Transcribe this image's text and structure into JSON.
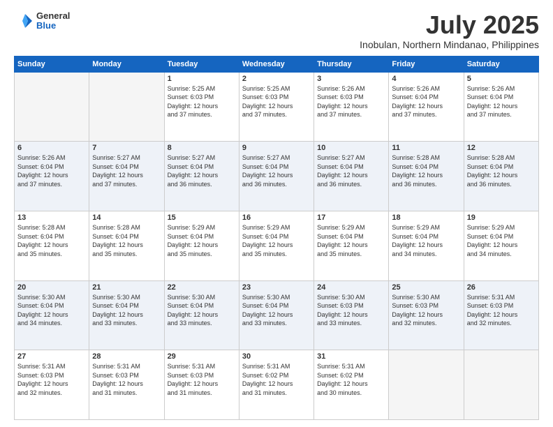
{
  "header": {
    "logo_general": "General",
    "logo_blue": "Blue",
    "month_title": "July 2025",
    "location": "Inobulan, Northern Mindanao, Philippines"
  },
  "weekdays": [
    "Sunday",
    "Monday",
    "Tuesday",
    "Wednesday",
    "Thursday",
    "Friday",
    "Saturday"
  ],
  "weeks": [
    [
      {
        "day": "",
        "info": ""
      },
      {
        "day": "",
        "info": ""
      },
      {
        "day": "1",
        "info": "Sunrise: 5:25 AM\nSunset: 6:03 PM\nDaylight: 12 hours\nand 37 minutes."
      },
      {
        "day": "2",
        "info": "Sunrise: 5:25 AM\nSunset: 6:03 PM\nDaylight: 12 hours\nand 37 minutes."
      },
      {
        "day": "3",
        "info": "Sunrise: 5:26 AM\nSunset: 6:03 PM\nDaylight: 12 hours\nand 37 minutes."
      },
      {
        "day": "4",
        "info": "Sunrise: 5:26 AM\nSunset: 6:04 PM\nDaylight: 12 hours\nand 37 minutes."
      },
      {
        "day": "5",
        "info": "Sunrise: 5:26 AM\nSunset: 6:04 PM\nDaylight: 12 hours\nand 37 minutes."
      }
    ],
    [
      {
        "day": "6",
        "info": "Sunrise: 5:26 AM\nSunset: 6:04 PM\nDaylight: 12 hours\nand 37 minutes."
      },
      {
        "day": "7",
        "info": "Sunrise: 5:27 AM\nSunset: 6:04 PM\nDaylight: 12 hours\nand 37 minutes."
      },
      {
        "day": "8",
        "info": "Sunrise: 5:27 AM\nSunset: 6:04 PM\nDaylight: 12 hours\nand 36 minutes."
      },
      {
        "day": "9",
        "info": "Sunrise: 5:27 AM\nSunset: 6:04 PM\nDaylight: 12 hours\nand 36 minutes."
      },
      {
        "day": "10",
        "info": "Sunrise: 5:27 AM\nSunset: 6:04 PM\nDaylight: 12 hours\nand 36 minutes."
      },
      {
        "day": "11",
        "info": "Sunrise: 5:28 AM\nSunset: 6:04 PM\nDaylight: 12 hours\nand 36 minutes."
      },
      {
        "day": "12",
        "info": "Sunrise: 5:28 AM\nSunset: 6:04 PM\nDaylight: 12 hours\nand 36 minutes."
      }
    ],
    [
      {
        "day": "13",
        "info": "Sunrise: 5:28 AM\nSunset: 6:04 PM\nDaylight: 12 hours\nand 35 minutes."
      },
      {
        "day": "14",
        "info": "Sunrise: 5:28 AM\nSunset: 6:04 PM\nDaylight: 12 hours\nand 35 minutes."
      },
      {
        "day": "15",
        "info": "Sunrise: 5:29 AM\nSunset: 6:04 PM\nDaylight: 12 hours\nand 35 minutes."
      },
      {
        "day": "16",
        "info": "Sunrise: 5:29 AM\nSunset: 6:04 PM\nDaylight: 12 hours\nand 35 minutes."
      },
      {
        "day": "17",
        "info": "Sunrise: 5:29 AM\nSunset: 6:04 PM\nDaylight: 12 hours\nand 35 minutes."
      },
      {
        "day": "18",
        "info": "Sunrise: 5:29 AM\nSunset: 6:04 PM\nDaylight: 12 hours\nand 34 minutes."
      },
      {
        "day": "19",
        "info": "Sunrise: 5:29 AM\nSunset: 6:04 PM\nDaylight: 12 hours\nand 34 minutes."
      }
    ],
    [
      {
        "day": "20",
        "info": "Sunrise: 5:30 AM\nSunset: 6:04 PM\nDaylight: 12 hours\nand 34 minutes."
      },
      {
        "day": "21",
        "info": "Sunrise: 5:30 AM\nSunset: 6:04 PM\nDaylight: 12 hours\nand 33 minutes."
      },
      {
        "day": "22",
        "info": "Sunrise: 5:30 AM\nSunset: 6:04 PM\nDaylight: 12 hours\nand 33 minutes."
      },
      {
        "day": "23",
        "info": "Sunrise: 5:30 AM\nSunset: 6:04 PM\nDaylight: 12 hours\nand 33 minutes."
      },
      {
        "day": "24",
        "info": "Sunrise: 5:30 AM\nSunset: 6:03 PM\nDaylight: 12 hours\nand 33 minutes."
      },
      {
        "day": "25",
        "info": "Sunrise: 5:30 AM\nSunset: 6:03 PM\nDaylight: 12 hours\nand 32 minutes."
      },
      {
        "day": "26",
        "info": "Sunrise: 5:31 AM\nSunset: 6:03 PM\nDaylight: 12 hours\nand 32 minutes."
      }
    ],
    [
      {
        "day": "27",
        "info": "Sunrise: 5:31 AM\nSunset: 6:03 PM\nDaylight: 12 hours\nand 32 minutes."
      },
      {
        "day": "28",
        "info": "Sunrise: 5:31 AM\nSunset: 6:03 PM\nDaylight: 12 hours\nand 31 minutes."
      },
      {
        "day": "29",
        "info": "Sunrise: 5:31 AM\nSunset: 6:03 PM\nDaylight: 12 hours\nand 31 minutes."
      },
      {
        "day": "30",
        "info": "Sunrise: 5:31 AM\nSunset: 6:02 PM\nDaylight: 12 hours\nand 31 minutes."
      },
      {
        "day": "31",
        "info": "Sunrise: 5:31 AM\nSunset: 6:02 PM\nDaylight: 12 hours\nand 30 minutes."
      },
      {
        "day": "",
        "info": ""
      },
      {
        "day": "",
        "info": ""
      }
    ]
  ]
}
